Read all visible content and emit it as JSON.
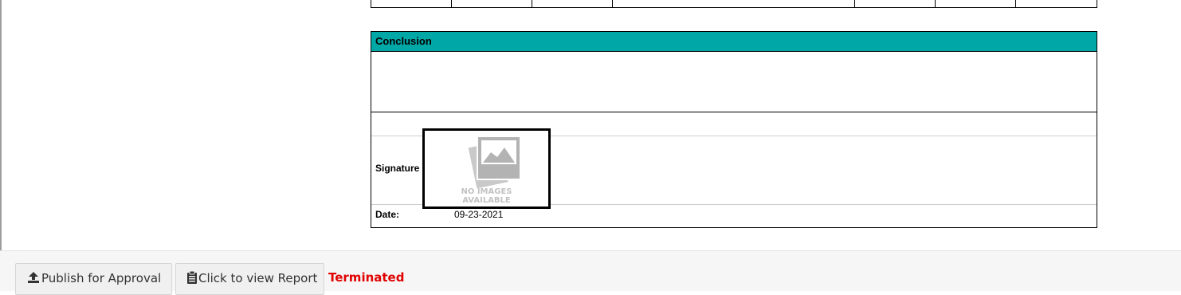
{
  "report": {
    "conclusion": {
      "header": "Conclusion",
      "body": ""
    },
    "signature": {
      "label": "Signature",
      "image_placeholder_line1": "NO IMAGES",
      "image_placeholder_line2": "AVAILABLE"
    },
    "date": {
      "label": "Date:",
      "value": "09-23-2021"
    }
  },
  "footer": {
    "publish_label": "Publish for Approval",
    "publish_icon": "upload-icon",
    "report_label": "Click to view Report",
    "report_icon": "clipboard-icon",
    "status_text": "Terminated"
  },
  "colors": {
    "section_header": "#00a7a7",
    "status": "#e00000"
  }
}
